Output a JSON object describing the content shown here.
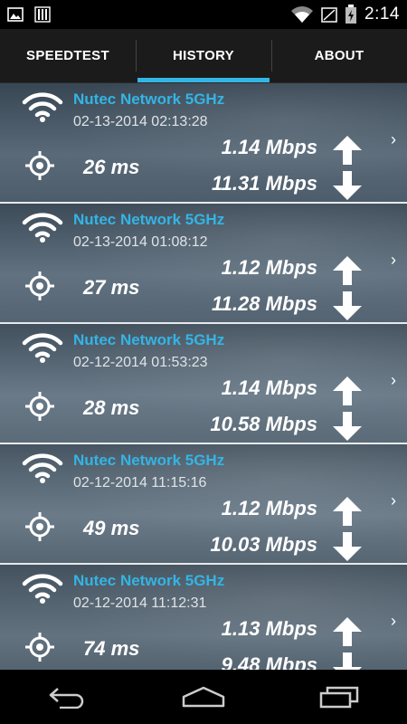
{
  "status_bar": {
    "time": "2:14",
    "icons": [
      "image-icon",
      "barcode-icon",
      "wifi-signal-icon",
      "battery-charging-icon"
    ]
  },
  "tabs": [
    {
      "label": "SPEEDTEST",
      "active": false
    },
    {
      "label": "HISTORY",
      "active": true
    },
    {
      "label": "ABOUT",
      "active": false
    }
  ],
  "colors": {
    "accent": "#33b5e5",
    "divider": "#e6e9ec"
  },
  "history": [
    {
      "network": "Nutec Network 5GHz",
      "timestamp": "02-13-2014 02:13:28",
      "ping": "26 ms",
      "upload": "1.14 Mbps",
      "download": "11.31 Mbps"
    },
    {
      "network": "Nutec Network 5GHz",
      "timestamp": "02-13-2014 01:08:12",
      "ping": "27 ms",
      "upload": "1.12 Mbps",
      "download": "11.28 Mbps"
    },
    {
      "network": "Nutec Network 5GHz",
      "timestamp": "02-12-2014 01:53:23",
      "ping": "28 ms",
      "upload": "1.14 Mbps",
      "download": "10.58 Mbps"
    },
    {
      "network": "Nutec Network 5GHz",
      "timestamp": "02-12-2014 11:15:16",
      "ping": "49 ms",
      "upload": "1.12 Mbps",
      "download": "10.03 Mbps"
    },
    {
      "network": "Nutec Network 5GHz",
      "timestamp": "02-12-2014 11:12:31",
      "ping": "74 ms",
      "upload": "1.13 Mbps",
      "download": "9.48 Mbps"
    }
  ],
  "nav": [
    "back-icon",
    "home-icon",
    "recent-apps-icon"
  ]
}
